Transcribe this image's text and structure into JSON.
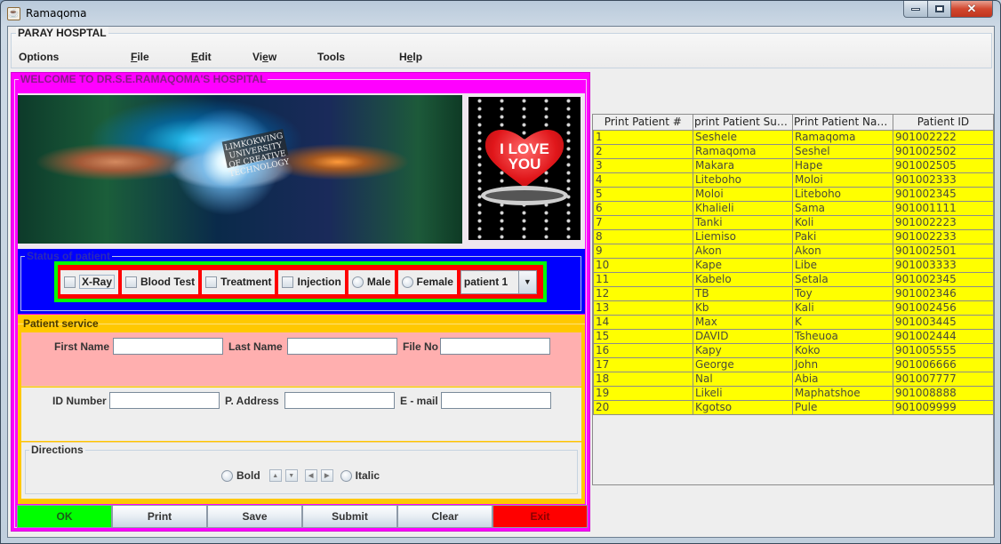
{
  "window": {
    "title": "Ramaqoma",
    "controls": {
      "minimize": "minimize-icon",
      "maximize": "maximize-icon",
      "close": "close-icon"
    }
  },
  "menu_panel": {
    "title": "PARAY HOSPTAL",
    "items": [
      {
        "label": "Options",
        "mnemonic": ""
      },
      {
        "label": "File",
        "mnemonic": "F"
      },
      {
        "label": "Edit",
        "mnemonic": "E"
      },
      {
        "label": "View",
        "mnemonic": "e"
      },
      {
        "label": "Tools",
        "mnemonic": ""
      },
      {
        "label": "Help",
        "mnemonic": "e"
      }
    ]
  },
  "welcome": {
    "title": "WELCOME TO DR.S.E.RAMAQOMA'S HOSPITAL",
    "banner_caption": "LIMKOKWING UNIVERSITY OF CREATIVE TECHNOLOGY",
    "love_text_line1": "I LOVE",
    "love_text_line2": "YOU"
  },
  "status": {
    "title": "Status of patient",
    "checkboxes": [
      {
        "label": "X-Ray",
        "checked": false
      },
      {
        "label": "Blood Test",
        "checked": false
      },
      {
        "label": "Treatment",
        "checked": false
      },
      {
        "label": "Injection",
        "checked": false
      }
    ],
    "radios": [
      {
        "label": "Male",
        "selected": false
      },
      {
        "label": "Female",
        "selected": false
      }
    ],
    "combo": {
      "value": "patient 1"
    }
  },
  "service": {
    "title": "Patient service",
    "fields": {
      "first_name": {
        "label": "First Name",
        "value": ""
      },
      "last_name": {
        "label": "Last Name",
        "value": ""
      },
      "file_no": {
        "label": "File No",
        "value": ""
      },
      "id_number": {
        "label": "ID Number",
        "value": ""
      },
      "p_address": {
        "label": "P. Address",
        "value": ""
      },
      "email": {
        "label": "E - mail",
        "value": ""
      }
    },
    "directions": {
      "title": "Directions",
      "bold_label": "Bold",
      "italic_label": "Italic"
    }
  },
  "buttons": {
    "ok": "OK",
    "print": "Print",
    "save": "Save",
    "submit": "Submit",
    "clear": "Clear",
    "exit": "Exit"
  },
  "colors": {
    "welcome_bg": "#ff00ff",
    "status_bg": "#0000ff",
    "status_inner": "#00ff00",
    "status_options_bg": "#ff0000",
    "service_bg": "#ffc800",
    "service_row1": "#ffafaf",
    "ok_button": "#00ff00",
    "exit_button": "#ff0000",
    "table_row": "#ffff00"
  },
  "table": {
    "headers": [
      "Print Patient #",
      "print Patient Surna...",
      "Print Patient Names",
      "Patient ID"
    ],
    "rows": [
      [
        "1",
        "Seshele",
        "Ramaqoma",
        "901002222"
      ],
      [
        "2",
        "Ramaqoma",
        "Seshel",
        "901002502"
      ],
      [
        "3",
        "Makara",
        "Hape",
        "901002505"
      ],
      [
        "4",
        "Liteboho",
        "Moloi",
        "901002333"
      ],
      [
        "5",
        "Moloi",
        "Liteboho",
        "901002345"
      ],
      [
        "6",
        "Khalieli",
        "Sama",
        "901001111"
      ],
      [
        "7",
        "Tanki",
        "Koli",
        "901002223"
      ],
      [
        "8",
        "Liemiso",
        "Paki",
        "901002233"
      ],
      [
        "9",
        "Akon",
        "Akon",
        "901002501"
      ],
      [
        "10",
        "Kape",
        "Libe",
        "901003333"
      ],
      [
        "11",
        "Kabelo",
        "Setala",
        "901002345"
      ],
      [
        "12",
        "TB",
        "Toy",
        "901002346"
      ],
      [
        "13",
        "Kb",
        "Kali",
        "901002456"
      ],
      [
        "14",
        "Max",
        "K",
        "901003445"
      ],
      [
        "15",
        "DAVID",
        "Tsheuoa",
        "901002444"
      ],
      [
        "16",
        "Kapy",
        "Koko",
        "901005555"
      ],
      [
        "17",
        "George",
        "John",
        "901006666"
      ],
      [
        "18",
        "Nal",
        "Abia",
        "901007777"
      ],
      [
        "19",
        "Likeli",
        "Maphatshoe",
        "901008888"
      ],
      [
        "20",
        "Kgotso",
        "Pule",
        "901009999"
      ]
    ]
  }
}
